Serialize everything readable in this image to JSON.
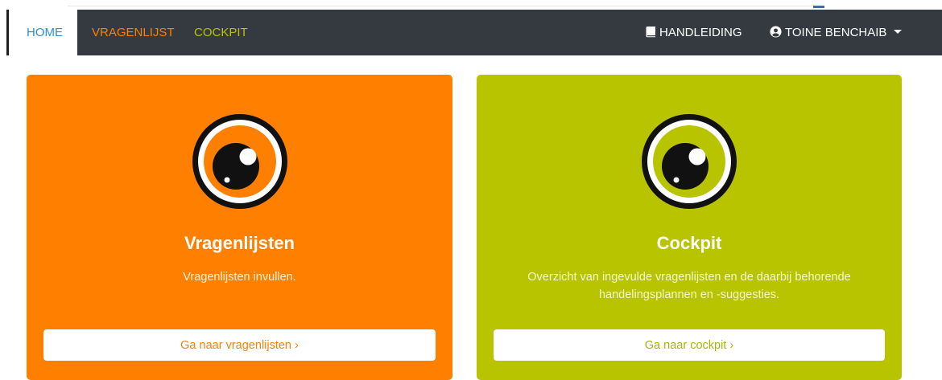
{
  "nav": {
    "home": "HOME",
    "vragenlijst": "VRAGENLIJST",
    "cockpit": "COCKPIT",
    "handleiding": "HANDLEIDING",
    "user": "TOINE BENCHAIB"
  },
  "cards": [
    {
      "title": "Vragenlijsten",
      "text": "Vragenlijsten invullen.",
      "button": "Ga naar vragenlijsten ›",
      "color": "#ff8000",
      "icon": "eye-icon"
    },
    {
      "title": "Cockpit",
      "text": "Overzicht van ingevulde vragenlijsten en de daarbij behorende handelingsplannen en -suggesties.",
      "button": "Ga naar cockpit ›",
      "color": "#b8c400",
      "icon": "eye-icon"
    }
  ],
  "colors": {
    "navbar": "#343a40",
    "home_link": "#2f8fd9",
    "vragenlijst_link": "#ff8000",
    "cockpit_link": "#b8c400"
  }
}
